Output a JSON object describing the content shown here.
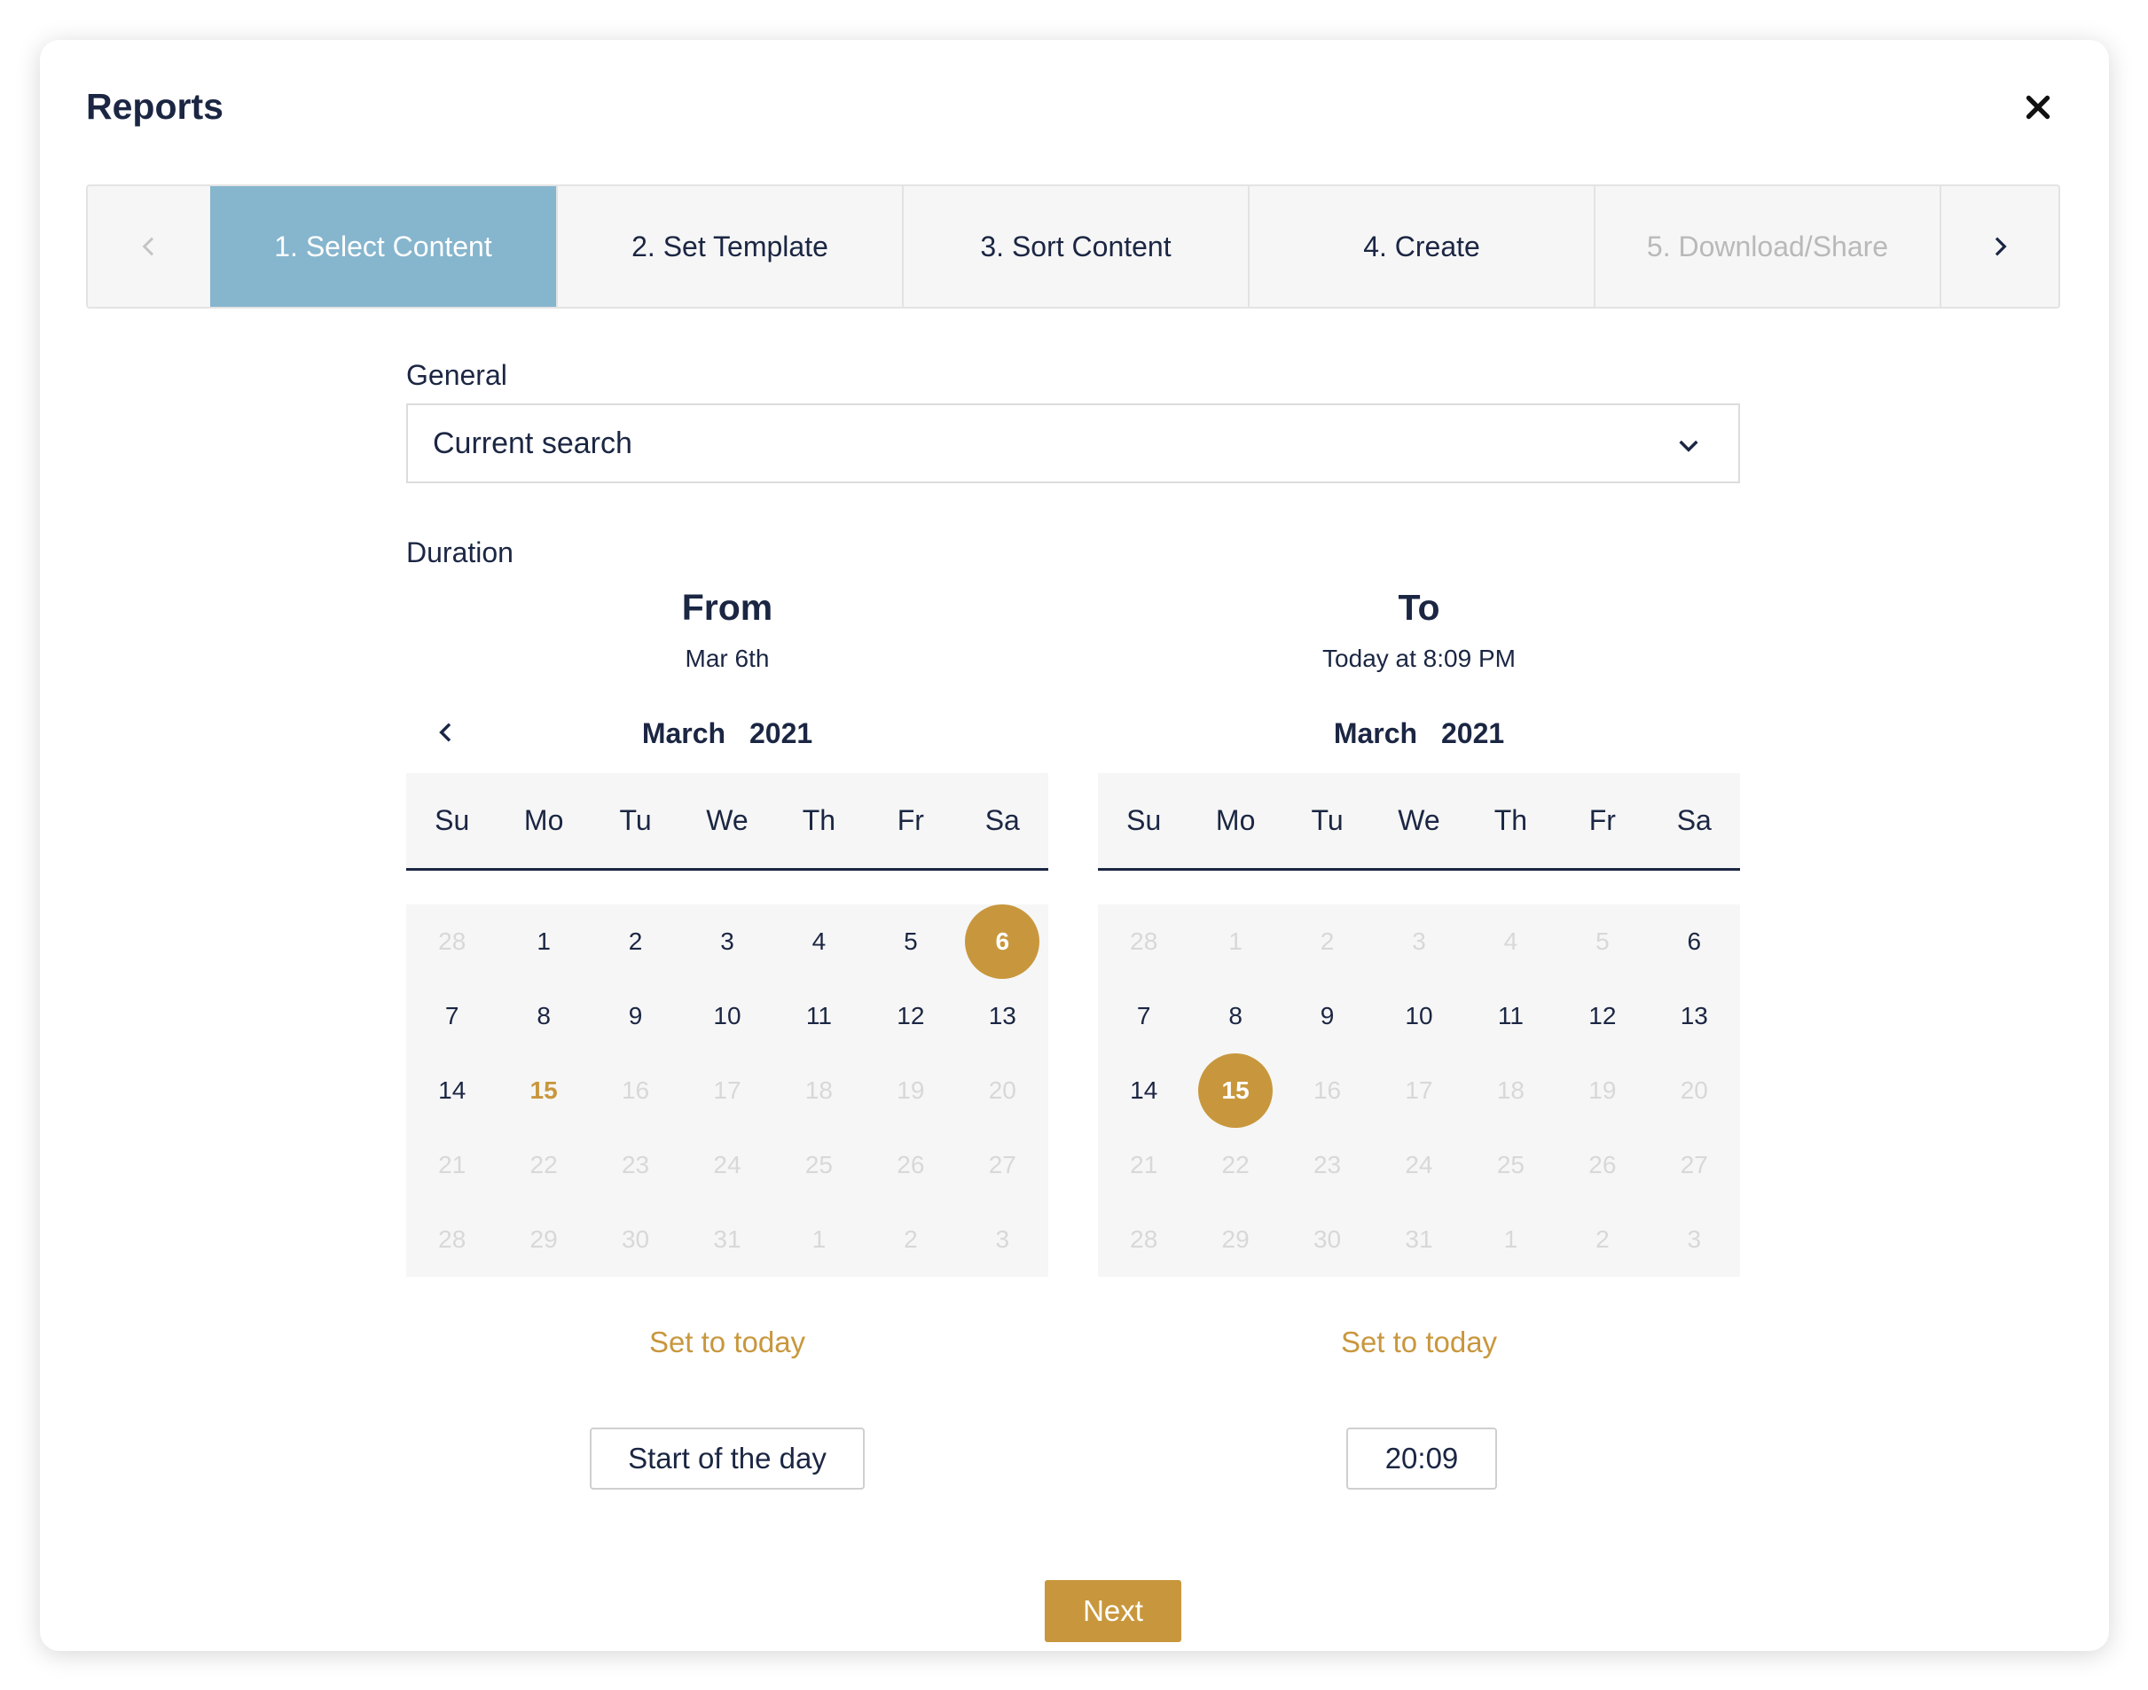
{
  "title": "Reports",
  "steps": [
    "1. Select Content",
    "2. Set Template",
    "3. Sort Content",
    "4. Create",
    "5. Download/Share"
  ],
  "general": {
    "label": "General",
    "value": "Current search"
  },
  "duration": {
    "label": "Duration"
  },
  "from": {
    "heading": "From",
    "sub": "Mar 6th",
    "month": "March",
    "year": "2021",
    "set_today": "Set to today",
    "time": "Start of the day"
  },
  "to": {
    "heading": "To",
    "sub": "Today at 8:09 PM",
    "month": "March",
    "year": "2021",
    "set_today": "Set to today",
    "time": "20:09"
  },
  "weekdays": [
    "Su",
    "Mo",
    "Tu",
    "We",
    "Th",
    "Fr",
    "Sa"
  ],
  "from_days": [
    [
      "28",
      "m"
    ],
    [
      "1",
      ""
    ],
    [
      "2",
      ""
    ],
    [
      "3",
      ""
    ],
    [
      "4",
      ""
    ],
    [
      "5",
      ""
    ],
    [
      "6",
      "sel"
    ],
    [
      "7",
      ""
    ],
    [
      "8",
      ""
    ],
    [
      "9",
      ""
    ],
    [
      "10",
      ""
    ],
    [
      "11",
      ""
    ],
    [
      "12",
      ""
    ],
    [
      "13",
      ""
    ],
    [
      "14",
      ""
    ],
    [
      "15",
      "today"
    ],
    [
      "16",
      "m"
    ],
    [
      "17",
      "m"
    ],
    [
      "18",
      "m"
    ],
    [
      "19",
      "m"
    ],
    [
      "20",
      "m"
    ],
    [
      "21",
      "m"
    ],
    [
      "22",
      "m"
    ],
    [
      "23",
      "m"
    ],
    [
      "24",
      "m"
    ],
    [
      "25",
      "m"
    ],
    [
      "26",
      "m"
    ],
    [
      "27",
      "m"
    ],
    [
      "28",
      "m"
    ],
    [
      "29",
      "m"
    ],
    [
      "30",
      "m"
    ],
    [
      "31",
      "m"
    ],
    [
      "1",
      "m"
    ],
    [
      "2",
      "m"
    ],
    [
      "3",
      "m"
    ]
  ],
  "to_days": [
    [
      "28",
      "m"
    ],
    [
      "1",
      "m"
    ],
    [
      "2",
      "m"
    ],
    [
      "3",
      "m"
    ],
    [
      "4",
      "m"
    ],
    [
      "5",
      "m"
    ],
    [
      "6",
      ""
    ],
    [
      "7",
      ""
    ],
    [
      "8",
      ""
    ],
    [
      "9",
      ""
    ],
    [
      "10",
      ""
    ],
    [
      "11",
      ""
    ],
    [
      "12",
      ""
    ],
    [
      "13",
      ""
    ],
    [
      "14",
      ""
    ],
    [
      "15",
      "sel"
    ],
    [
      "16",
      "m"
    ],
    [
      "17",
      "m"
    ],
    [
      "18",
      "m"
    ],
    [
      "19",
      "m"
    ],
    [
      "20",
      "m"
    ],
    [
      "21",
      "m"
    ],
    [
      "22",
      "m"
    ],
    [
      "23",
      "m"
    ],
    [
      "24",
      "m"
    ],
    [
      "25",
      "m"
    ],
    [
      "26",
      "m"
    ],
    [
      "27",
      "m"
    ],
    [
      "28",
      "m"
    ],
    [
      "29",
      "m"
    ],
    [
      "30",
      "m"
    ],
    [
      "31",
      "m"
    ],
    [
      "1",
      "m"
    ],
    [
      "2",
      "m"
    ],
    [
      "3",
      "m"
    ]
  ],
  "next_label": "Next",
  "colors": {
    "accent": "#c8973d",
    "active_step": "#86b5ce",
    "text": "#1b2643"
  },
  "icons": {
    "close": "close-icon",
    "prev": "chevron-left-icon",
    "next": "chevron-right-icon",
    "dropdown": "chevron-down-icon"
  }
}
